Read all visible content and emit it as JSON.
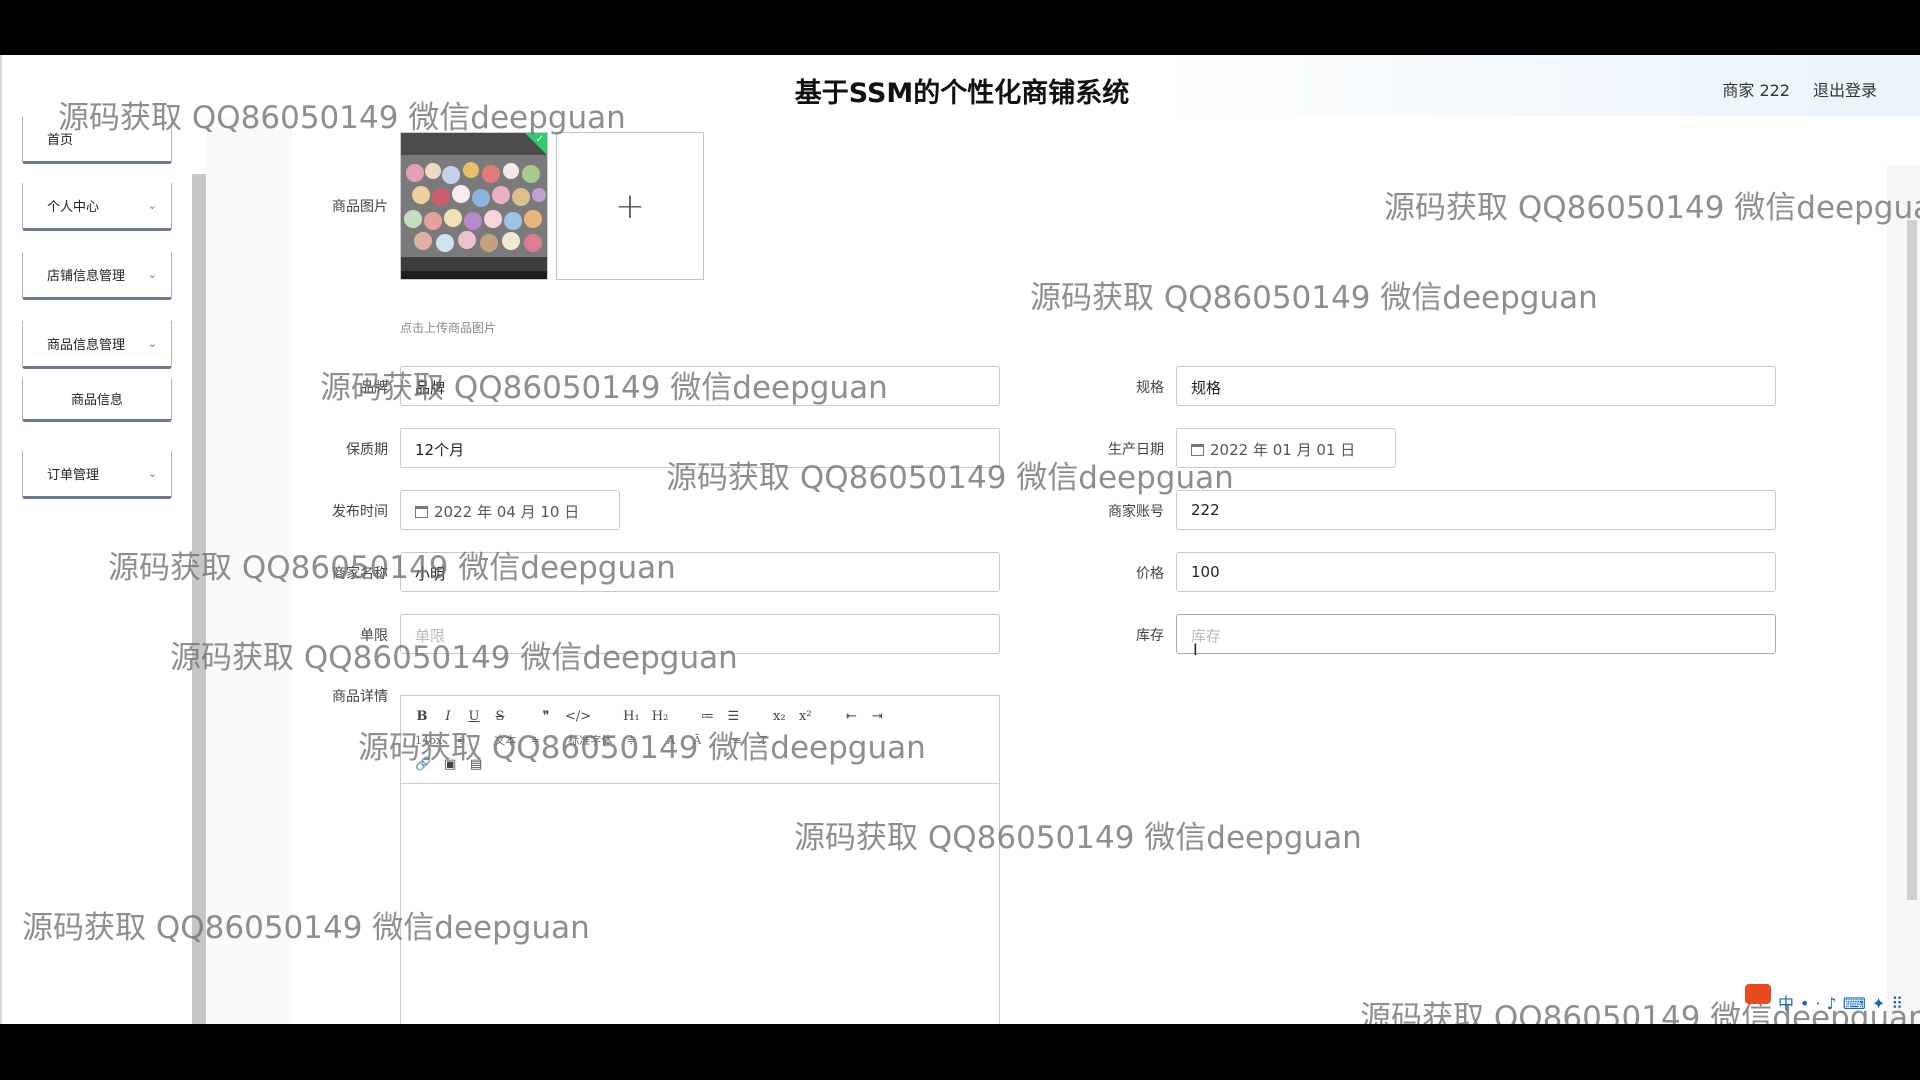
{
  "header": {
    "title": "基于SSM的个性化商铺系统",
    "user": "商家 222",
    "logout": "退出登录"
  },
  "sidebar": {
    "items": [
      {
        "label": "首页",
        "has_chevron": false
      },
      {
        "label": "个人中心",
        "has_chevron": true
      },
      {
        "label": "店铺信息管理",
        "has_chevron": true
      },
      {
        "label": "商品信息管理",
        "has_chevron": true
      },
      {
        "label": "商品信息",
        "has_chevron": false
      },
      {
        "label": "订单管理",
        "has_chevron": true
      }
    ],
    "chevron": "⌄"
  },
  "form": {
    "image_label": "商品图片",
    "upload_plus": "+",
    "upload_hint": "点击上传商品图片",
    "brand_label": "品牌",
    "brand_value": "品牌",
    "spec_label": "规格",
    "spec_value": "规格",
    "shelf_label": "保质期",
    "shelf_value": "12个月",
    "prod_date_label": "生产日期",
    "prod_date_value": "2022 年 01 月 01 日",
    "publish_label": "发布时间",
    "publish_value": "2022 年 04 月 10 日",
    "merchant_acct_label": "商家账号",
    "merchant_acct_value": "222",
    "merchant_name_label": "商家名称",
    "merchant_name_value": "小明",
    "price_label": "价格",
    "price_value": "100",
    "limit_label": "单限",
    "limit_placeholder": "单限",
    "stock_label": "库存",
    "stock_placeholder": "库存",
    "detail_label": "商品详情"
  },
  "editor": {
    "row1": [
      "B",
      "I",
      "U",
      "S",
      "❞",
      "</>",
      "H₁",
      "H₂",
      "≔",
      "☰",
      "x₂",
      "x²",
      "⇤",
      "⇥"
    ],
    "row2": [
      "14px",
      "≑",
      "文本",
      "≑",
      "标准字体",
      "≑",
      "A",
      "Ā",
      "≡",
      "T̸"
    ],
    "row3": [
      "🔗",
      "▣",
      "▤"
    ]
  },
  "watermark": "源码获取 QQ86050149 微信deepguan",
  "tray_icons": "中•·♪⌨✦⠿"
}
